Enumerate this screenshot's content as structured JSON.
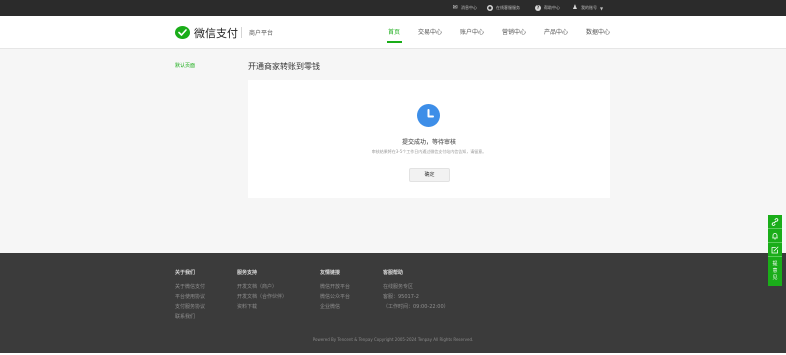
{
  "topbar": {
    "items": [
      {
        "icon": "mail-icon",
        "label": "消息中心"
      },
      {
        "icon": "service-icon",
        "label": "在线客服服务"
      },
      {
        "icon": "help-icon",
        "label": "帮助中心"
      },
      {
        "icon": "user-icon",
        "label": "我的账号"
      }
    ]
  },
  "header": {
    "logo_text": "微信支付",
    "merchant_label": "商户平台",
    "nav": [
      "首页",
      "交易中心",
      "账户中心",
      "营销中心",
      "产品中心",
      "数据中心"
    ],
    "active_nav_index": 0
  },
  "sidebar": {
    "link": "默认页面"
  },
  "main": {
    "title": "开通商家转账到零钱",
    "status_icon": "clock-icon",
    "status_main": "提交成功，等待审核",
    "status_sub": "审核结果将在3-5个工作日内通过微信支付站内信告知，请留意。",
    "ok_button": "确定"
  },
  "footer": {
    "columns": [
      {
        "heading": "关于我们",
        "links": [
          "关于微信支付",
          "平台使用协议",
          "支付服务协议",
          "联系我们"
        ]
      },
      {
        "heading": "服务支持",
        "links": [
          "开发文档（商户）",
          "开发文档（合作伙伴）",
          "资料下载"
        ]
      },
      {
        "heading": "友情链接",
        "links": [
          "微信开放平台",
          "微信公众平台",
          "企业微信"
        ]
      },
      {
        "heading": "客服帮助",
        "links": [
          "在线服务专区",
          "客服：95017-2",
          "（工作时间：09:00-22:00）"
        ]
      }
    ],
    "copyright": "Powered By Tencent & Tenpay   Copyright 2005-2024 Tenpay All Rights Reserved."
  },
  "side_tools": {
    "icons": [
      "link-icon",
      "bell-icon",
      "edit-icon"
    ],
    "feedback_label": "提意见"
  },
  "colors": {
    "brand": "#1aad19",
    "status_blue": "#3d8ee8",
    "footer_bg": "#3b3b3b",
    "topbar_bg": "#2b2b2b"
  }
}
